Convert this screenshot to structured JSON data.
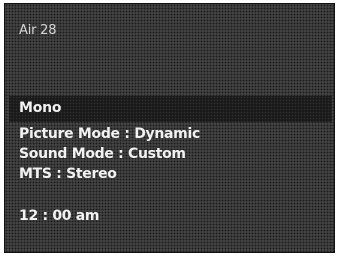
{
  "osd": {
    "channel": "Air 28",
    "audio_mode": "Mono",
    "picture_mode": "Picture Mode : Dynamic",
    "sound_mode": "Sound Mode : Custom",
    "mts": "MTS : Stereo",
    "time": "12 : 00 am"
  }
}
